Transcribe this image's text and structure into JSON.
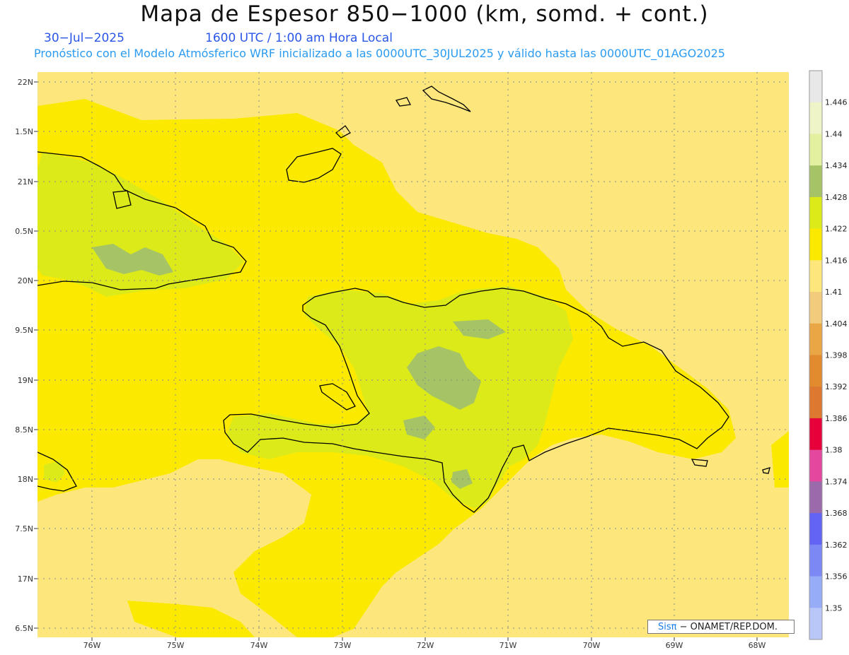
{
  "header": {
    "title": "Mapa de Espesor 850−1000 (km, somd. + cont.)",
    "date": "30−Jul−2025",
    "time": "1600 UTC / 1:00 am Hora Local",
    "forecast": "Pronóstico con el Modelo Atmósferico WRF inicializado a las 0000UTC_30JUL2025 y válido hasta las  0000UTC_01AGO2025"
  },
  "axes": {
    "lat_labels": [
      "22N",
      "1.5N",
      "21N",
      "0.5N",
      "20N",
      "9.5N",
      "19N",
      "8.5N",
      "18N",
      "7.5N",
      "17N",
      "6.5N"
    ],
    "lon_labels": [
      "76W",
      "75W",
      "74W",
      "73W",
      "72W",
      "71W",
      "70W",
      "69W",
      "68W"
    ]
  },
  "colorbar": {
    "levels": [
      "1.446",
      "1.44",
      "1.434",
      "1.428",
      "1.422",
      "1.416",
      "1.41",
      "1.404",
      "1.398",
      "1.392",
      "1.386",
      "1.38",
      "1.374",
      "1.368",
      "1.362",
      "1.356",
      "1.35"
    ],
    "colors": [
      "#e8e8e8",
      "#eef3c8",
      "#e2f0a0",
      "#a6c466",
      "#dcea1a",
      "#fbe900",
      "#fde77c",
      "#f2cc7c",
      "#eaa544",
      "#e28a2e",
      "#dc7830",
      "#e8003a",
      "#e3489e",
      "#9a6aaa",
      "#6464f4",
      "#7c88f4",
      "#96acf6",
      "#b8c6f8"
    ]
  },
  "credit": {
    "sis": "Sisπ",
    "org": " − ONAMET/REP.DOM."
  }
}
